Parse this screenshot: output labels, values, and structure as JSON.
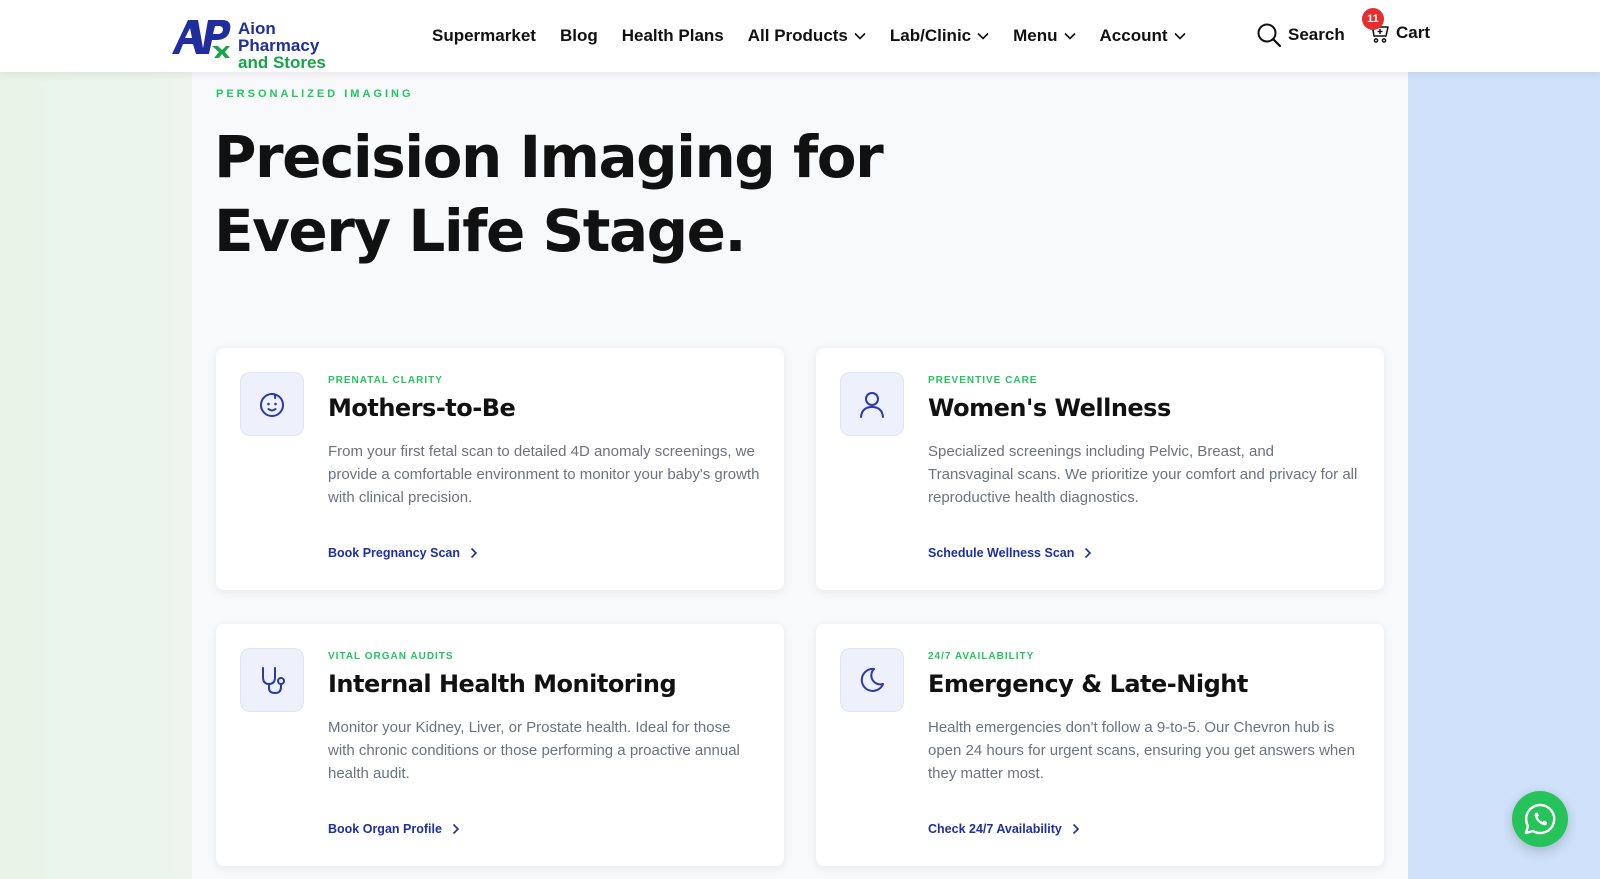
{
  "brand": {
    "logo_line1": "Aion Pharmacy",
    "logo_line2": "and Stores",
    "colors": {
      "primary": "#1f2d9e",
      "accent": "#19a34a",
      "badge": "#e62e2e"
    }
  },
  "nav": {
    "items": [
      {
        "label": "Supermarket",
        "dropdown": false
      },
      {
        "label": "Blog",
        "dropdown": false
      },
      {
        "label": "Health Plans",
        "dropdown": false
      },
      {
        "label": "All Products",
        "dropdown": true
      },
      {
        "label": "Lab/Clinic",
        "dropdown": true
      },
      {
        "label": "Menu",
        "dropdown": true
      },
      {
        "label": "Account",
        "dropdown": true
      }
    ],
    "search_label": "Search",
    "cart_label": "Cart",
    "cart_count": "11"
  },
  "hero": {
    "eyebrow": "PERSONALIZED IMAGING",
    "title_line1": "Precision Imaging for",
    "title_line2": "Every Life Stage."
  },
  "cards": [
    {
      "icon": "baby-face-icon",
      "tag": "PRENATAL CLARITY",
      "title": "Mothers-to-Be",
      "description": "From your first fetal scan to detailed 4D anomaly screenings, we provide a comfortable environment to monitor your baby's growth with clinical precision.",
      "link": "Book Pregnancy Scan"
    },
    {
      "icon": "user-icon",
      "tag": "PREVENTIVE CARE",
      "title": "Women's Wellness",
      "description": "Specialized screenings including Pelvic, Breast, and Transvaginal scans. We prioritize your comfort and privacy for all reproductive health diagnostics.",
      "link": "Schedule Wellness Scan"
    },
    {
      "icon": "stethoscope-icon",
      "tag": "VITAL ORGAN AUDITS",
      "title": "Internal Health Monitoring",
      "description": "Monitor your Kidney, Liver, or Prostate health. Ideal for those with chronic conditions or those performing a proactive annual health audit.",
      "link": "Book Organ Profile"
    },
    {
      "icon": "moon-icon",
      "tag": "24/7 AVAILABILITY",
      "title": "Emergency & Late-Night",
      "description": "Health emergencies don't follow a 9-to-5. Our Chevron hub is open 24 hours for urgent scans, ensuring you get answers when they matter most.",
      "link": "Check 24/7 Availability"
    }
  ],
  "floating": {
    "icon": "whatsapp-icon"
  }
}
